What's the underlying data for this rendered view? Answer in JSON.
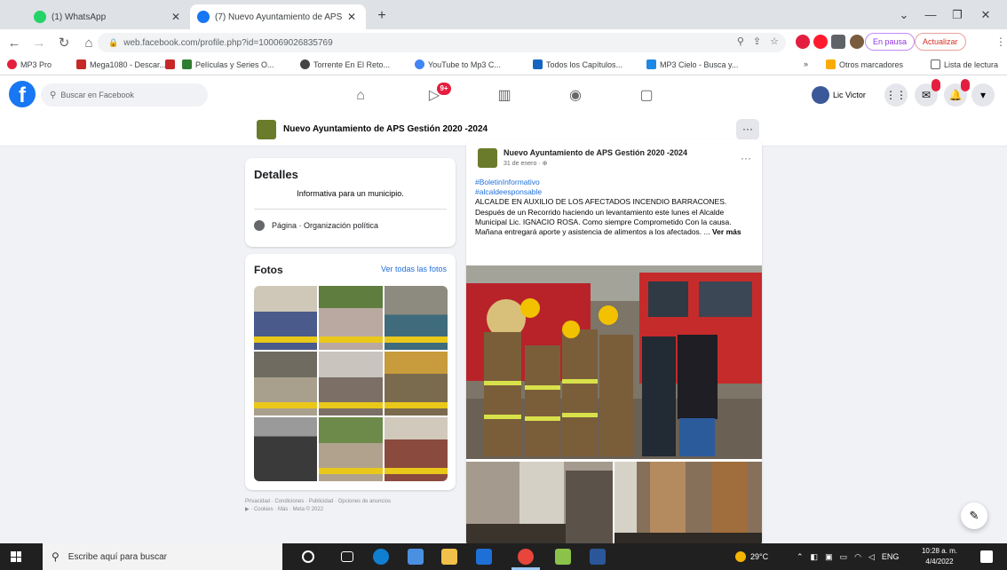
{
  "browser": {
    "tabs": [
      {
        "title": "(1) WhatsApp",
        "active": false
      },
      {
        "title": "(7) Nuevo Ayuntamiento de APS",
        "active": true
      }
    ],
    "url": "web.facebook.com/profile.php?id=100069026835769",
    "profile_label": "En pausa",
    "update_label": "Actualizar",
    "bookmarks": [
      "MP3 Pro",
      "Mega1080 - Descar...",
      "Películas y Series O...",
      "Torrente En El Reto...",
      "YouTube to Mp3 C...",
      "Todos los Capítulos...",
      "MP3 Cielo - Busca y...",
      "Otros marcadores",
      "Lista de lectura"
    ]
  },
  "facebook": {
    "search_placeholder": "Buscar en Facebook",
    "watch_badge": "9+",
    "user_name": "Lic Victor"
  },
  "page": {
    "name": "Nuevo Ayuntamiento de APS Gestión 2020 -2024",
    "more": "···"
  },
  "details": {
    "title": "Detalles",
    "description": "Informativa para un municipio.",
    "category": "Página · Organización política"
  },
  "photos": {
    "title": "Fotos",
    "see_all": "Ver todas las fotos"
  },
  "footer": {
    "line1": "Privacidad · Condiciones · Publicidad · Opciones de anuncios",
    "line2": "▶ · Cookies · Más · Meta © 2022"
  },
  "post": {
    "author": "Nuevo Ayuntamiento de APS Gestión 2020 -2024",
    "date": "31 de enero · ⊕",
    "more": "···",
    "hashtag1": "#BoletinInformativo",
    "hashtag2": "#alcaldeesponsable",
    "body": "ALCALDE EN AUXILIO DE LOS AFECTADOS INCENDIO BARRACONES. Después de un Recorrido haciendo un levantamiento este lunes el Alcalde Municipal Lic. IGNACIO ROSA. Como siempre Comprometido Con la causa. Mañana entregará aporte y asistencia de alimentos a los afectados. ...",
    "see_more": "Ver más"
  },
  "taskbar": {
    "search_placeholder": "Escribe aquí para buscar",
    "temperature": "29°C",
    "language": "ENG",
    "time": "10:28 a. m.",
    "date": "4/4/2022"
  },
  "colors": {
    "fb_blue": "#1877f2",
    "link_blue": "#216fdb",
    "badge_red": "#e41e3f"
  }
}
